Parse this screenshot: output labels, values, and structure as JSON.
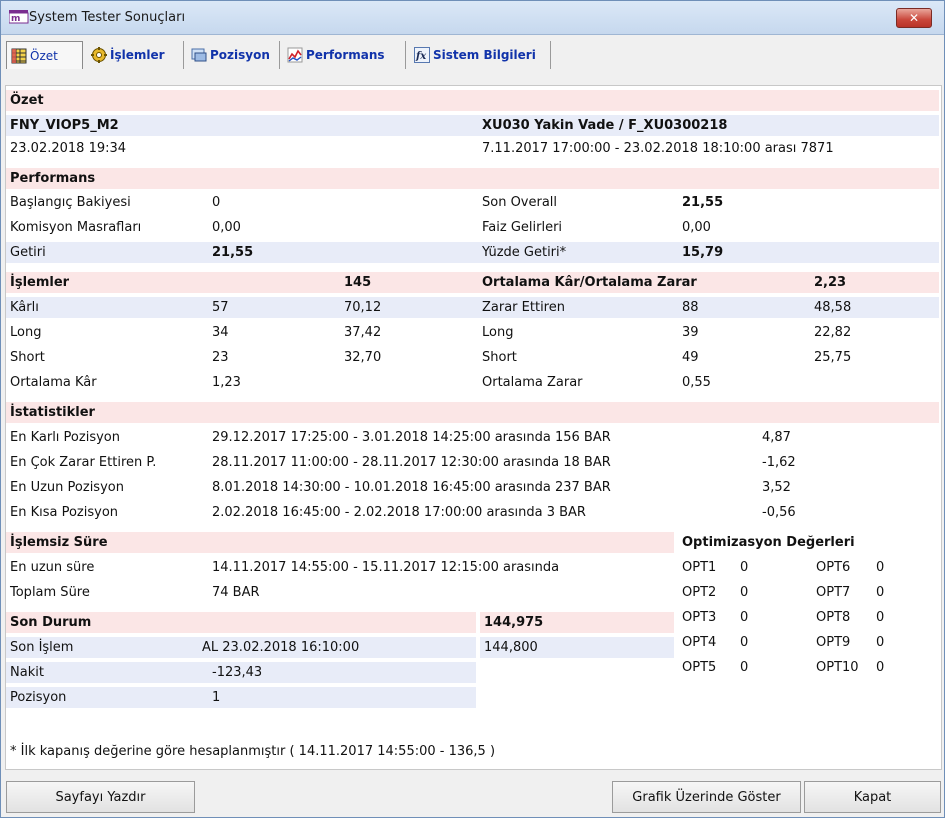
{
  "window": {
    "title": "System Tester Sonuçları",
    "close_glyph": "✕"
  },
  "tabs": [
    {
      "label": "Özet",
      "icon": "grid-icon",
      "active": true
    },
    {
      "label": "İşlemler",
      "icon": "gear-coins-icon"
    },
    {
      "label": "Pozisyon",
      "icon": "position-icon"
    },
    {
      "label": "Performans",
      "icon": "chart-icon"
    },
    {
      "label": "Sistem Bilgileri",
      "icon": "fx-icon"
    }
  ],
  "ozet": {
    "section_title": "Özet",
    "system_name": "FNY_VIOP5_M2",
    "symbol": "XU030 Yakin Vade / F_XU0300218",
    "run_datetime": "23.02.2018 19:34",
    "range": "7.11.2017 17:00:00 - 23.02.2018 18:10:00 arası 7871"
  },
  "performans": {
    "section_title": "Performans",
    "rows": [
      {
        "l_label": "Başlangıç Bakiyesi",
        "l_value": "0",
        "r_label": "Son Overall",
        "r_value": "21,55"
      },
      {
        "l_label": "Komisyon Masrafları",
        "l_value": "0,00",
        "r_label": "Faiz Gelirleri",
        "r_value": "0,00"
      },
      {
        "l_label": "Getiri",
        "l_value": "21,55",
        "r_label": "Yüzde Getiri*",
        "r_value": "15,79"
      }
    ]
  },
  "islemler": {
    "section_title": "İşlemler",
    "count": "145",
    "right_title": "Ortalama Kâr/Ortalama Zarar",
    "right_value": "2,23",
    "rows": [
      {
        "l_label": "Kârlı",
        "l_count": "57",
        "l_value": "70,12",
        "r_label": "Zarar Ettiren",
        "r_count": "88",
        "r_value": "48,58"
      },
      {
        "l_label": "Long",
        "l_count": "34",
        "l_value": "37,42",
        "r_label": "Long",
        "r_count": "39",
        "r_value": "22,82"
      },
      {
        "l_label": "Short",
        "l_count": "23",
        "l_value": "32,70",
        "r_label": "Short",
        "r_count": "49",
        "r_value": "25,75"
      },
      {
        "l_label": "Ortalama Kâr",
        "l_count": "1,23",
        "l_value": "",
        "r_label": "Ortalama Zarar",
        "r_count": "0,55",
        "r_value": ""
      }
    ]
  },
  "istatistikler": {
    "section_title": "İstatistikler",
    "rows": [
      {
        "label": "En Karlı Pozisyon",
        "detail": "29.12.2017 17:25:00 - 3.01.2018 14:25:00 arasında 156 BAR",
        "value": "4,87"
      },
      {
        "label": "En Çok Zarar Ettiren P.",
        "detail": "28.11.2017 11:00:00 - 28.11.2017 12:30:00 arasında 18 BAR",
        "value": "-1,62"
      },
      {
        "label": "En Uzun Pozisyon",
        "detail": "8.01.2018 14:30:00 - 10.01.2018 16:45:00 arasında 237 BAR",
        "value": "3,52"
      },
      {
        "label": "En Kısa Pozisyon",
        "detail": "2.02.2018 16:45:00 - 2.02.2018 17:00:00 arasında 3 BAR",
        "value": "-0,56"
      }
    ]
  },
  "islemsiz": {
    "section_title": "İşlemsiz Süre",
    "longest_label": "En uzun süre",
    "longest_value": "14.11.2017 14:55:00 - 15.11.2017 12:15:00 arasında",
    "total_label": "Toplam Süre",
    "total_value": "74 BAR"
  },
  "optimizasyon": {
    "title": "Optimizasyon Değerleri",
    "left": [
      {
        "name": "OPT1",
        "value": "0"
      },
      {
        "name": "OPT2",
        "value": "0"
      },
      {
        "name": "OPT3",
        "value": "0"
      },
      {
        "name": "OPT4",
        "value": "0"
      },
      {
        "name": "OPT5",
        "value": "0"
      }
    ],
    "right": [
      {
        "name": "OPT6",
        "value": "0"
      },
      {
        "name": "OPT7",
        "value": "0"
      },
      {
        "name": "OPT8",
        "value": "0"
      },
      {
        "name": "OPT9",
        "value": "0"
      },
      {
        "name": "OPT10",
        "value": "0"
      }
    ]
  },
  "son_durum": {
    "section_title": "Son Durum",
    "total_value": "144,975",
    "son_islem_label": "Son İşlem",
    "son_islem_value": "AL  23.02.2018 16:10:00",
    "son_islem_price": "144,800",
    "nakit_label": "Nakit",
    "nakit_value": "-123,43",
    "pozisyon_label": "Pozisyon",
    "pozisyon_value": "1"
  },
  "footnote": "* İlk kapanış değerine göre hesaplanmıştır ( 14.11.2017 14:55:00 - 136,5 )",
  "buttons": {
    "print": "Sayfayı Yazdır",
    "show_on_chart": "Grafik Üzerinde Göster",
    "close": "Kapat"
  }
}
